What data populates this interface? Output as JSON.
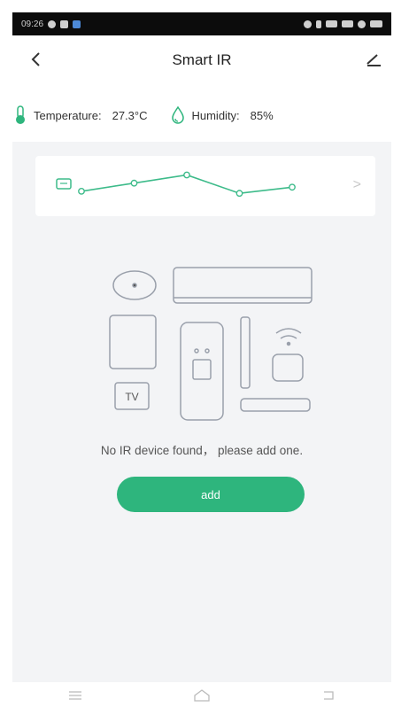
{
  "status_bar": {
    "time": "09:26",
    "icons": [
      "notification-icon",
      "app-icon",
      "app-icon-blue",
      "location-icon",
      "nfc-icon",
      "signal-icon",
      "signal-icon",
      "wifi-icon",
      "battery-icon"
    ]
  },
  "header": {
    "title": "Smart IR",
    "back_icon": "chevron-left-icon",
    "edit_icon": "pencil-icon"
  },
  "sensors": {
    "temperature": {
      "label": "Temperature:",
      "value": "27.3°C",
      "icon": "thermometer-icon"
    },
    "humidity": {
      "label": "Humidity:",
      "value": "85%",
      "icon": "droplet-icon"
    }
  },
  "trend_chart": {
    "values": [
      0.35,
      0.55,
      0.75,
      0.3,
      0.45
    ],
    "line_color": "#3dbb8a",
    "chevron": ">"
  },
  "empty_state": {
    "illustration_labels": {
      "tv": "TV"
    },
    "message": "No IR device found， please add one.",
    "add_button": "add"
  },
  "colors": {
    "accent": "#2eb57d",
    "background": "#f3f4f6"
  },
  "nav": [
    "menu-icon",
    "home-icon",
    "back-icon"
  ]
}
